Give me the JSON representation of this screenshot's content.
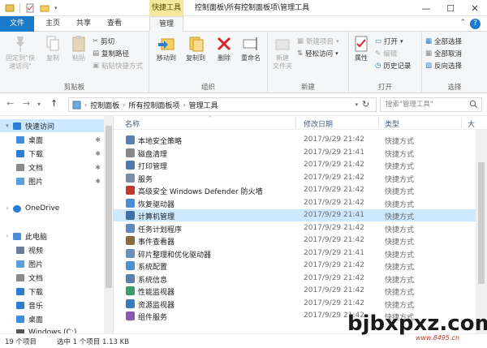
{
  "titlebar": {
    "context_tab": "快捷工具",
    "title": "控制面板\\所有控制面板项\\管理工具"
  },
  "ribbon_tabs": [
    "文件",
    "主页",
    "共享",
    "查看",
    "管理"
  ],
  "ribbon": {
    "clipboard": {
      "label": "剪贴板",
      "pin": "固定到\"快\n速访问\"",
      "copy": "复制",
      "paste": "粘贴",
      "cut": "剪切",
      "copy_path": "复制路径",
      "paste_shortcut": "粘贴快捷方式"
    },
    "organize": {
      "label": "组织",
      "move_to": "移动到",
      "copy_to": "复制到",
      "delete": "删除",
      "rename": "重命名"
    },
    "new": {
      "label": "新建",
      "new_folder": "新建\n文件夹",
      "new_item": "新建项目",
      "easy_access": "轻松访问"
    },
    "open": {
      "label": "打开",
      "properties": "属性",
      "open": "打开",
      "edit": "编辑",
      "history": "历史记录"
    },
    "select": {
      "label": "选择",
      "select_all": "全部选择",
      "select_none": "全部取消",
      "invert": "反向选择"
    }
  },
  "address": {
    "parts": [
      "控制面板",
      "所有控制面板项",
      "管理工具"
    ],
    "search_placeholder": "搜索\"管理工具\""
  },
  "nav_pane": {
    "items": [
      {
        "label": "快速访问",
        "level": 0,
        "pin": false,
        "selected": true,
        "icon": "star-icon"
      },
      {
        "label": "桌面",
        "level": 1,
        "pin": true,
        "selected": false,
        "icon": "desktop-icon"
      },
      {
        "label": "下载",
        "level": 1,
        "pin": true,
        "selected": false,
        "icon": "download-icon"
      },
      {
        "label": "文档",
        "level": 1,
        "pin": true,
        "selected": false,
        "icon": "document-icon"
      },
      {
        "label": "图片",
        "level": 1,
        "pin": true,
        "selected": false,
        "icon": "picture-icon"
      },
      {
        "label": "OneDrive",
        "level": 0,
        "pin": false,
        "selected": false,
        "icon": "cloud-icon"
      },
      {
        "label": "此电脑",
        "level": 0,
        "pin": false,
        "selected": false,
        "icon": "computer-icon"
      },
      {
        "label": "视频",
        "level": 1,
        "pin": false,
        "selected": false,
        "icon": "video-icon"
      },
      {
        "label": "图片",
        "level": 1,
        "pin": false,
        "selected": false,
        "icon": "picture-icon"
      },
      {
        "label": "文档",
        "level": 1,
        "pin": false,
        "selected": false,
        "icon": "document-icon"
      },
      {
        "label": "下载",
        "level": 1,
        "pin": false,
        "selected": false,
        "icon": "download-icon"
      },
      {
        "label": "音乐",
        "level": 1,
        "pin": false,
        "selected": false,
        "icon": "music-icon"
      },
      {
        "label": "桌面",
        "level": 1,
        "pin": false,
        "selected": false,
        "icon": "desktop-icon"
      },
      {
        "label": "Windows (C:)",
        "level": 1,
        "pin": false,
        "selected": false,
        "icon": "drive-icon"
      }
    ]
  },
  "file_list": {
    "columns": [
      "名称",
      "修改日期",
      "类型",
      "大"
    ],
    "rows": [
      {
        "name": "本地安全策略",
        "date": "2017/9/29 21:42",
        "type": "快捷方式",
        "selected": false
      },
      {
        "name": "磁盘清理",
        "date": "2017/9/29 21:41",
        "type": "快捷方式",
        "selected": false
      },
      {
        "name": "打印管理",
        "date": "2017/9/29 21:42",
        "type": "快捷方式",
        "selected": false
      },
      {
        "name": "服务",
        "date": "2017/9/29 21:42",
        "type": "快捷方式",
        "selected": false
      },
      {
        "name": "高级安全 Windows Defender 防火墙",
        "date": "2017/9/29 21:42",
        "type": "快捷方式",
        "selected": false
      },
      {
        "name": "恢复驱动器",
        "date": "2017/9/29 21:42",
        "type": "快捷方式",
        "selected": false
      },
      {
        "name": "计算机管理",
        "date": "2017/9/29 21:41",
        "type": "快捷方式",
        "selected": true
      },
      {
        "name": "任务计划程序",
        "date": "2017/9/29 21:42",
        "type": "快捷方式",
        "selected": false
      },
      {
        "name": "事件查看器",
        "date": "2017/9/29 21:42",
        "type": "快捷方式",
        "selected": false
      },
      {
        "name": "碎片整理和优化驱动器",
        "date": "2017/9/29 21:41",
        "type": "快捷方式",
        "selected": false
      },
      {
        "name": "系统配置",
        "date": "2017/9/29 21:42",
        "type": "快捷方式",
        "selected": false
      },
      {
        "name": "系统信息",
        "date": "2017/9/29 21:42",
        "type": "快捷方式",
        "selected": false
      },
      {
        "name": "性能监视器",
        "date": "2017/9/29 21:42",
        "type": "快捷方式",
        "selected": false
      },
      {
        "name": "资源监视器",
        "date": "2017/9/29 21:42",
        "type": "快捷方式",
        "selected": false
      },
      {
        "name": "组件服务",
        "date": "2017/9/29 21:42",
        "type": "快捷方式",
        "selected": false
      }
    ]
  },
  "status": {
    "count": "19 个项目",
    "selection": "选中 1 个项目  1.13 KB"
  },
  "watermark": {
    "big": "bjbxpxz.com",
    "small": "www.8495.cn"
  },
  "colors": {
    "accent": "#1979ca",
    "selection": "#cce8ff",
    "context_tab": "#f5e89a"
  }
}
